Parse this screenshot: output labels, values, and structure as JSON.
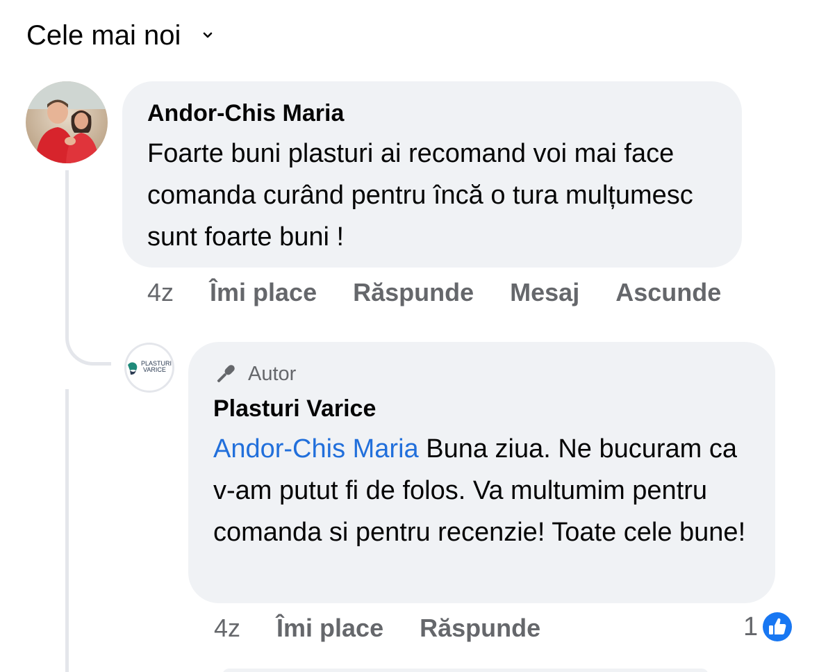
{
  "sort": {
    "label": "Cele mai noi"
  },
  "comments": [
    {
      "author": "Andor-Chis Maria",
      "text": "Foarte buni plasturi ai recomand voi mai face comanda curând pentru încă o tura mulțumesc sunt foarte buni !",
      "time": "4z",
      "actions": [
        "Îmi place",
        "Răspunde",
        "Mesaj",
        "Ascunde"
      ]
    }
  ],
  "reply": {
    "badge": "Autor",
    "author": "Plasturi Varice",
    "mention": "Andor-Chis Maria",
    "text": "Buna ziua. Ne bucuram ca v-am putut fi de folos. Va multumim pentru comanda si pentru recenzie! Toate cele bune!",
    "time": "4z",
    "actions": [
      "Îmi place",
      "Răspunde"
    ],
    "reaction_count": "1",
    "avatar_logo_line1": "PLASTURI",
    "avatar_logo_line2": "VARICE"
  },
  "colors": {
    "bubble_bg": "#f0f2f5",
    "muted_text": "#65676b",
    "link_blue": "#216fdb",
    "like_blue": "#1877f2"
  }
}
